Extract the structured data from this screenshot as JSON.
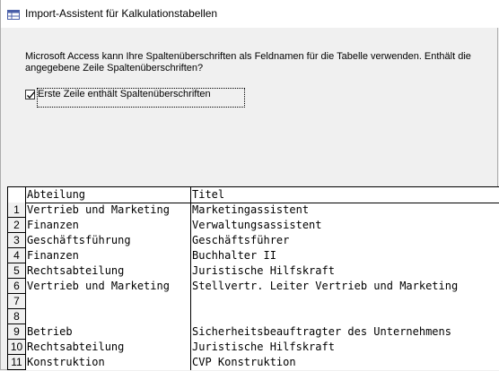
{
  "window": {
    "title": "Import-Assistent für Kalkulationstabellen",
    "icon": "spreadsheet-import-icon"
  },
  "intro_text": "Microsoft Access kann Ihre Spaltenüberschriften als Feldnamen für die Tabelle verwenden. Enthält die angegebene Zeile Spaltenüberschriften?",
  "header_checkbox": {
    "label": "Erste Zeile enthält Spaltenüberschriften",
    "checked": true
  },
  "grid": {
    "columns": [
      "Abteilung",
      "Titel"
    ],
    "rows": [
      {
        "num": "1",
        "abteilung": "Vertrieb und Marketing",
        "titel": "Marketingassistent"
      },
      {
        "num": "2",
        "abteilung": "Finanzen",
        "titel": "Verwaltungsassistent"
      },
      {
        "num": "3",
        "abteilung": "Geschäftsführung",
        "titel": "Geschäftsführer"
      },
      {
        "num": "4",
        "abteilung": "Finanzen",
        "titel": "Buchhalter II"
      },
      {
        "num": "5",
        "abteilung": "Rechtsabteilung",
        "titel": "Juristische Hilfskraft"
      },
      {
        "num": "6",
        "abteilung": "Vertrieb und Marketing",
        "titel": "Stellvertr. Leiter Vertrieb und Marketing"
      },
      {
        "num": "7",
        "abteilung": "",
        "titel": ""
      },
      {
        "num": "8",
        "abteilung": "",
        "titel": ""
      },
      {
        "num": "9",
        "abteilung": "Betrieb",
        "titel": "Sicherheitsbeauftragter des Unternehmens"
      },
      {
        "num": "10",
        "abteilung": "Rechtsabteilung",
        "titel": "Juristische Hilfskraft"
      },
      {
        "num": "11",
        "abteilung": "Konstruktion",
        "titel": "CVP Konstruktion"
      }
    ]
  }
}
